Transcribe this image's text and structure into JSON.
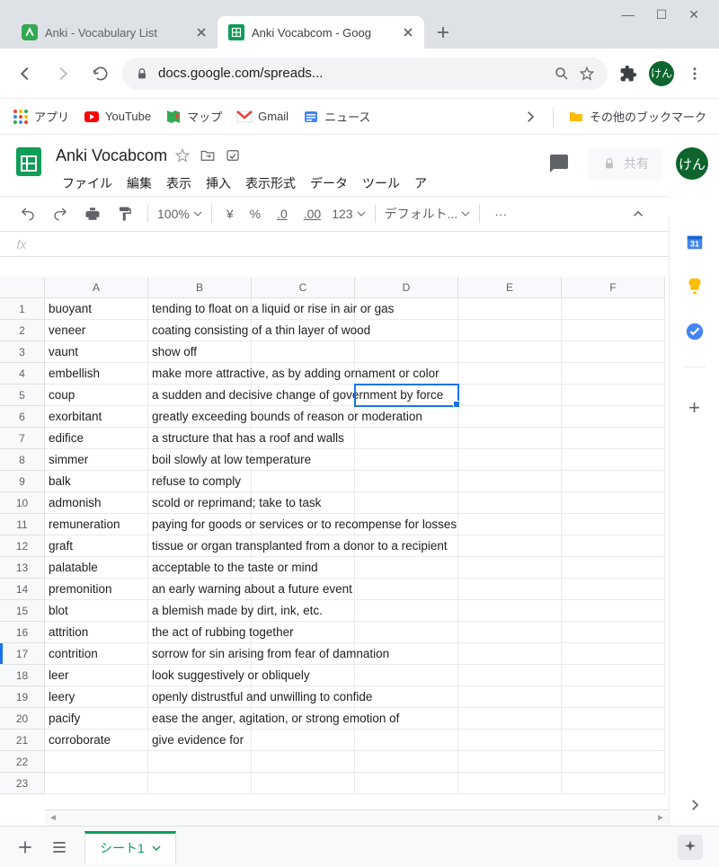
{
  "browser": {
    "tabs": [
      {
        "label": "Anki - Vocabulary List ",
        "active": false
      },
      {
        "label": "Anki Vocabcom - Goog",
        "active": true
      }
    ],
    "url": "docs.google.com/spreads...",
    "avatar_text": "けん",
    "bookmarks": {
      "apps": "アプリ",
      "youtube": "YouTube",
      "maps": "マップ",
      "gmail": "Gmail",
      "news": "ニュース",
      "other": "その他のブックマーク"
    }
  },
  "sheets": {
    "doc_title": "Anki Vocabcom",
    "menus": [
      "ファイル",
      "編集",
      "表示",
      "挿入",
      "表示形式",
      "データ",
      "ツール",
      "ア"
    ],
    "share_label": "共有",
    "avatar_text": "けん",
    "toolbar": {
      "zoom": "100%",
      "currency": "¥",
      "percent": "%",
      "dec_dec": ".0",
      "dec_inc": ".00",
      "numfmt": "123",
      "font": "デフォルト...",
      "more": "···"
    },
    "columns": [
      "A",
      "B",
      "C",
      "D",
      "E",
      "F"
    ],
    "selected_cell": "D5",
    "rows": [
      {
        "n": 1,
        "a": "buoyant",
        "b": "tending to float on a liquid or rise in air or gas"
      },
      {
        "n": 2,
        "a": "veneer",
        "b": "coating consisting of a thin layer of wood"
      },
      {
        "n": 3,
        "a": "vaunt",
        "b": "show off"
      },
      {
        "n": 4,
        "a": "embellish",
        "b": "make more attractive, as by adding ornament or color"
      },
      {
        "n": 5,
        "a": "coup",
        "b": "a sudden and decisive change of government by force"
      },
      {
        "n": 6,
        "a": "exorbitant",
        "b": "greatly exceeding bounds of reason or moderation"
      },
      {
        "n": 7,
        "a": "edifice",
        "b": "a structure that has a roof and walls"
      },
      {
        "n": 8,
        "a": "simmer",
        "b": "boil slowly at low temperature"
      },
      {
        "n": 9,
        "a": "balk",
        "b": "refuse to comply"
      },
      {
        "n": 10,
        "a": "admonish",
        "b": "scold or reprimand; take to task"
      },
      {
        "n": 11,
        "a": "remuneration",
        "b": "paying for goods or services or to recompense for losses"
      },
      {
        "n": 12,
        "a": "graft",
        "b": "tissue or organ transplanted from a donor to a recipient"
      },
      {
        "n": 13,
        "a": "palatable",
        "b": "acceptable to the taste or mind"
      },
      {
        "n": 14,
        "a": "premonition",
        "b": "an early warning about a future event"
      },
      {
        "n": 15,
        "a": "blot",
        "b": "a blemish made by dirt, ink, etc."
      },
      {
        "n": 16,
        "a": "attrition",
        "b": "the act of rubbing together"
      },
      {
        "n": 17,
        "a": "contrition",
        "b": "sorrow for sin arising from fear of damnation"
      },
      {
        "n": 18,
        "a": "leer",
        "b": "look suggestively or obliquely"
      },
      {
        "n": 19,
        "a": "leery",
        "b": "openly distrustful and unwilling to confide"
      },
      {
        "n": 20,
        "a": "pacify",
        "b": "ease the anger, agitation, or strong emotion of"
      },
      {
        "n": 21,
        "a": "corroborate",
        "b": "give evidence for"
      },
      {
        "n": 22,
        "a": "",
        "b": ""
      },
      {
        "n": 23,
        "a": "",
        "b": ""
      }
    ],
    "sheet_tab": "シート1"
  }
}
